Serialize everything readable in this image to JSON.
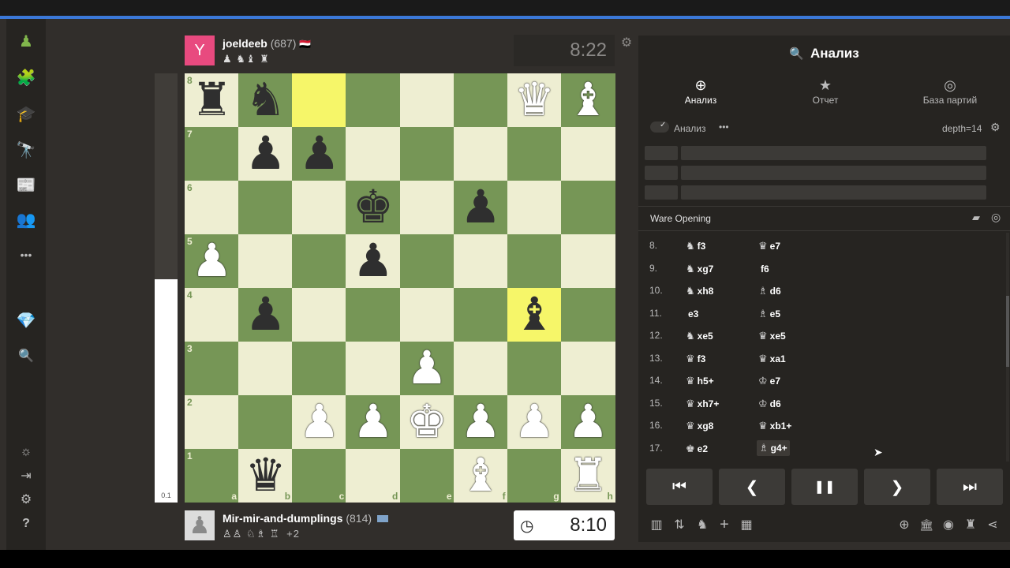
{
  "sidebar": {
    "items": [
      {
        "name": "play",
        "glyph": "♟"
      },
      {
        "name": "puzzles",
        "glyph": "🧩"
      },
      {
        "name": "learn",
        "glyph": "🎓"
      },
      {
        "name": "watch",
        "glyph": "🔭"
      },
      {
        "name": "news",
        "glyph": "📰"
      },
      {
        "name": "social",
        "glyph": "👥"
      },
      {
        "name": "more",
        "glyph": "•••"
      },
      {
        "name": "premium",
        "glyph": "💎"
      },
      {
        "name": "search",
        "glyph": "🔍"
      }
    ],
    "bottom": [
      {
        "name": "theme",
        "glyph": "☼"
      },
      {
        "name": "collapse",
        "glyph": "⇥"
      },
      {
        "name": "settings",
        "glyph": "⚙"
      },
      {
        "name": "help",
        "glyph": "?"
      }
    ]
  },
  "eval": {
    "label": "0.1",
    "white_fraction": 0.52
  },
  "top_player": {
    "avatar_letter": "Y",
    "name": "joeldeeb",
    "rating": "(687)",
    "flag": "🇾🇪",
    "captured": "♟ ♞♝ ♜",
    "clock": "8:22"
  },
  "bottom_player": {
    "name": "Mir-mir-and-dumplings",
    "rating": "(814)",
    "captured": "♙♙ ♘♗ ♖",
    "plus": "+2",
    "clock": "8:10",
    "clock_icon": "◷"
  },
  "board": {
    "files": [
      "a",
      "b",
      "c",
      "d",
      "e",
      "f",
      "g",
      "h"
    ],
    "ranks": [
      "8",
      "7",
      "6",
      "5",
      "4",
      "3",
      "2",
      "1"
    ],
    "highlights": [
      "c8",
      "g4"
    ],
    "pieces": {
      "a8": "♜b",
      "b8": "♞b",
      "g8": "♛w",
      "h8": "♝w",
      "b7": "♟b",
      "c7": "♟b",
      "d6": "♚b",
      "f6": "♟b",
      "a5": "♟w",
      "d5": "♟b",
      "b4": "♟b",
      "g4": "♝b",
      "e3": "♟w",
      "c2": "♟w",
      "d2": "♟w",
      "e2": "♚w",
      "f2": "♟w",
      "g2": "♟w",
      "h2": "♟w",
      "b1": "♛b",
      "f1": "♝w",
      "h1": "♜w"
    }
  },
  "panel": {
    "title": "Анализ",
    "title_icon": "🔍",
    "tabs": [
      {
        "label": "Анализ",
        "icon": "⊕"
      },
      {
        "label": "Отчет",
        "icon": "★"
      },
      {
        "label": "База партий",
        "icon": "◎"
      }
    ],
    "analysis_toggle": "Анализ",
    "more": "•••",
    "depth": "depth=14",
    "opening": "Ware Opening",
    "moves": [
      {
        "n": "8.",
        "w_fig": "♞",
        "w": "f3",
        "b_fig": "♛",
        "b": "e7"
      },
      {
        "n": "9.",
        "w_fig": "♞",
        "w": "xg7",
        "b_fig": "",
        "b": "f6"
      },
      {
        "n": "10.",
        "w_fig": "♞",
        "w": "xh8",
        "b_fig": "♗",
        "b": "d6"
      },
      {
        "n": "11.",
        "w_fig": "",
        "w": "e3",
        "b_fig": "♗",
        "b": "e5"
      },
      {
        "n": "12.",
        "w_fig": "♞",
        "w": "xe5",
        "b_fig": "♛",
        "b": "xe5"
      },
      {
        "n": "13.",
        "w_fig": "♛",
        "w": "f3",
        "b_fig": "♛",
        "b": "xa1"
      },
      {
        "n": "14.",
        "w_fig": "♛",
        "w": "h5+",
        "b_fig": "♔",
        "b": "e7"
      },
      {
        "n": "15.",
        "w_fig": "♛",
        "w": "xh7+",
        "b_fig": "♔",
        "b": "d6"
      },
      {
        "n": "16.",
        "w_fig": "♛",
        "w": "xg8",
        "b_fig": "♛",
        "b": "xb1+"
      },
      {
        "n": "17.",
        "w_fig": "♚",
        "w": "e2",
        "b_fig": "♗",
        "b": "g4+"
      }
    ],
    "controls": [
      "⏮",
      "❮",
      "❚❚",
      "❯",
      "⏭"
    ],
    "tools_left": [
      "▥",
      "⇅",
      "♞",
      "+",
      "▦"
    ],
    "tools_right": [
      "⊕",
      "🏛",
      "◉",
      "♜",
      "⋖"
    ]
  },
  "settings_icon": "⚙",
  "colors": {
    "light": "#eeeed2",
    "dark": "#769656",
    "highlight": "#f6f669"
  }
}
